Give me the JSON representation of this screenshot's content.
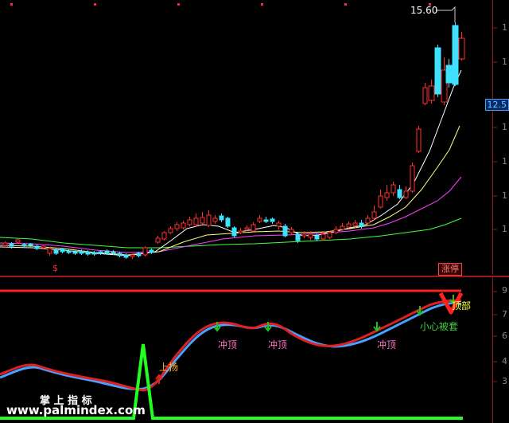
{
  "upper_chart": {
    "high_label": "15.60",
    "current_price": "12.5",
    "axis_ticks": [
      "1",
      "1",
      "1",
      "1",
      "1",
      "1"
    ],
    "limit_badge": "涨停",
    "dollar_marker": "$",
    "colors": {
      "up": "#ff3030",
      "down": "#40e0ff",
      "ma5": "#ffffff",
      "ma10": "#ffff80",
      "ma20": "#ff40ff",
      "ma60": "#40ff40"
    }
  },
  "lower_chart": {
    "axis_ticks": [
      "9",
      "7",
      "6",
      "4",
      "3"
    ],
    "annotations": {
      "rise": "上扬",
      "top": "顶部",
      "careful": "小心被套",
      "surge": [
        "冲顶",
        "冲顶",
        "冲顶"
      ]
    },
    "colors": {
      "ref_line": "#ff2020",
      "fast": "#e02020",
      "slow": "#4aa0ff",
      "signal": "#20ff20",
      "arrow_down": "#20c020",
      "top_mark": "#ff2020"
    }
  },
  "watermark": {
    "title": "掌 上 指 标",
    "url": "www.palmindex.com"
  },
  "chart_data": [
    {
      "type": "candlestick",
      "title": "",
      "xlabel": "",
      "ylabel": "",
      "high_annotation": 15.6,
      "last_price_label": 12.5,
      "grid": false,
      "series": []
    },
    {
      "type": "line",
      "title": "",
      "xlabel": "",
      "ylabel": "",
      "ytick_labels": [
        "9",
        "7",
        "6",
        "4",
        "3"
      ],
      "grid": false,
      "series": []
    }
  ]
}
